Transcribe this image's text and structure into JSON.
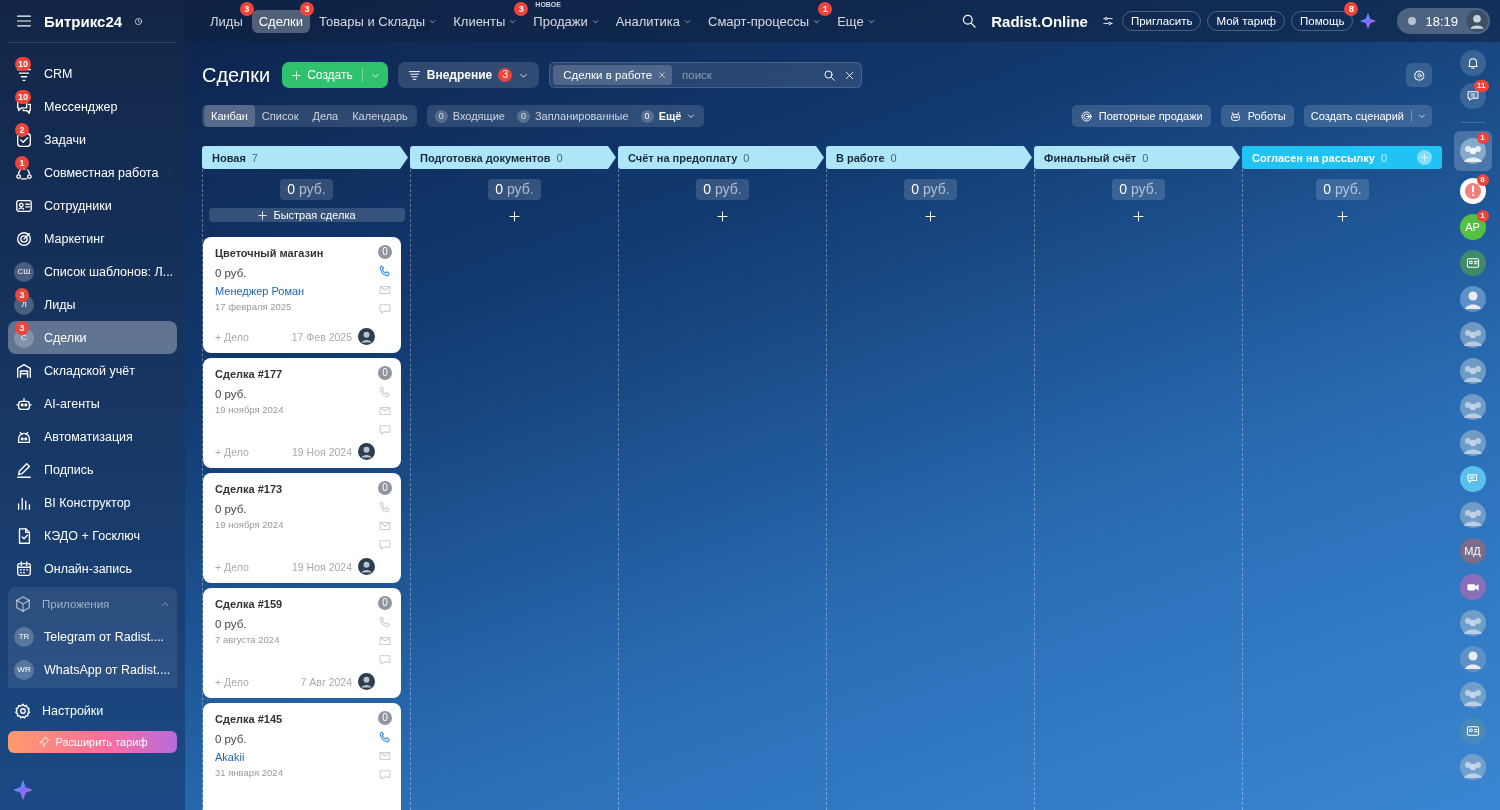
{
  "sidebar": {
    "logo": "Битрикс24",
    "items": [
      {
        "kind": "crm",
        "label": "CRM",
        "badge": "10",
        "submenu": false,
        "selected": false
      },
      {
        "kind": "messenger",
        "label": "Мессенджер",
        "badge": "10",
        "submenu": false,
        "selected": false
      },
      {
        "kind": "tasks",
        "label": "Задачи",
        "badge": "2",
        "submenu": false,
        "selected": false
      },
      {
        "kind": "collab",
        "label": "Совместная работа",
        "badge": "1",
        "submenu": true,
        "selected": false
      },
      {
        "kind": "staff",
        "label": "Сотрудники",
        "submenu": false,
        "selected": false
      },
      {
        "kind": "marketing",
        "label": "Маркетинг",
        "submenu": false,
        "selected": false
      },
      {
        "kind": "initials",
        "initials": "СШ",
        "label": "Список шаблонов: Л...",
        "submenu": false,
        "selected": false
      },
      {
        "kind": "initials",
        "initials": "Л",
        "label": "Лиды",
        "badge": "3",
        "submenu": false,
        "selected": false
      },
      {
        "kind": "initials",
        "initials": "С",
        "label": "Сделки",
        "badge": "3",
        "submenu": false,
        "selected": true
      },
      {
        "kind": "warehouse",
        "label": "Складской учёт",
        "submenu": false,
        "selected": false
      },
      {
        "kind": "ai",
        "label": "AI-агенты",
        "submenu": false,
        "selected": false
      },
      {
        "kind": "automation",
        "label": "Автоматизация",
        "submenu": false,
        "selected": false
      },
      {
        "kind": "sign",
        "label": "Подпись",
        "submenu": false,
        "selected": false
      },
      {
        "kind": "bi",
        "label": "BI Конструктор",
        "submenu": false,
        "selected": false
      },
      {
        "kind": "kedo",
        "label": "КЭДО + Госключ",
        "submenu": false,
        "selected": false
      },
      {
        "kind": "booking",
        "label": "Онлайн-запись",
        "submenu": false,
        "selected": false
      }
    ],
    "apps": {
      "title": "Приложения",
      "expanded": true,
      "items": [
        {
          "initials": "TR",
          "label": "Telegram от Radist...."
        },
        {
          "initials": "WR",
          "label": "WhatsApp от Radist...."
        }
      ]
    },
    "settings": "Настройки",
    "upgrade_button": "Расширить тариф"
  },
  "top_nav": {
    "items": [
      {
        "label": "Лиды",
        "badge": "3",
        "dropdown": false,
        "selected": false
      },
      {
        "label": "Сделки",
        "badge": "3",
        "dropdown": false,
        "selected": true
      },
      {
        "label": "Товары и Склады",
        "dropdown": true,
        "selected": false
      },
      {
        "label": "Клиенты",
        "badge": "3",
        "dropdown": true,
        "selected": false
      },
      {
        "label": "Продажи",
        "tag": "НОВОЕ",
        "dropdown": true,
        "selected": false
      },
      {
        "label": "Аналитика",
        "dropdown": true,
        "selected": false
      },
      {
        "label": "Смарт-процессы",
        "badge": "1",
        "dropdown": true,
        "selected": false
      },
      {
        "label": "Еще",
        "dropdown": true,
        "selected": false
      }
    ],
    "portal": "Radist.Online",
    "buttons": [
      "Пригласить",
      "Мой тариф"
    ],
    "help": {
      "label": "Помощь",
      "badge": "8"
    },
    "time": "18:19"
  },
  "toolbar": {
    "title": "Сделки",
    "create_button": "Создать",
    "pipeline": {
      "label": "Внедрение",
      "badge": "3"
    },
    "filter": {
      "chip": "Сделки в работе",
      "placeholder": "поиск"
    },
    "view_tabs": [
      {
        "label": "Канбан",
        "selected": true
      },
      {
        "label": "Список",
        "selected": false
      },
      {
        "label": "Дела",
        "selected": false
      },
      {
        "label": "Календарь",
        "selected": false
      }
    ],
    "counters": [
      {
        "count": "0",
        "label": "Входящие",
        "dropdown": false
      },
      {
        "count": "0",
        "label": "Запланированные",
        "dropdown": false
      },
      {
        "count": "0",
        "label": "Ещё",
        "dropdown": true
      }
    ],
    "actions": [
      {
        "kind": "repeat",
        "label": "Повторные продажи"
      },
      {
        "kind": "robots",
        "label": "Роботы"
      }
    ],
    "scenario_button": "Создать сценарий"
  },
  "kanban": {
    "columns": [
      {
        "title": "Новая",
        "count": "7",
        "color": "#aee6f9",
        "last": false,
        "total_value": "0",
        "total_unit": "руб.",
        "quick_add": "Быстрая сделка",
        "cards": [
          {
            "title": "Цветочный магазин",
            "amount": "0 руб.",
            "contact": "Менеджер Роман",
            "date": "17 февраля 2025",
            "activity": "+ Дело",
            "short_date": "17 Фев 2025",
            "counter": "0",
            "phone_active": true
          },
          {
            "title": "Сделка #177",
            "amount": "0 руб.",
            "date": "19 ноября 2024",
            "activity": "+ Дело",
            "short_date": "19 Ноя 2024",
            "counter": "0",
            "phone_active": false
          },
          {
            "title": "Сделка #173",
            "amount": "0 руб.",
            "date": "19 ноября 2024",
            "activity": "+ Дело",
            "short_date": "19 Ноя 2024",
            "counter": "0",
            "phone_active": false
          },
          {
            "title": "Сделка #159",
            "amount": "0 руб.",
            "date": "7 августа 2024",
            "activity": "+ Дело",
            "short_date": "7 Авг 2024",
            "counter": "0",
            "phone_active": false
          },
          {
            "title": "Сделка #145",
            "amount": "0 руб.",
            "contact": "Akakii",
            "date": "31 января 2024",
            "counter": "0",
            "phone_active": true
          }
        ]
      },
      {
        "title": "Подготовка документов",
        "count": "0",
        "color": "#aee6f9",
        "last": false,
        "total_value": "0",
        "total_unit": "руб."
      },
      {
        "title": "Счёт на предоплату",
        "count": "0",
        "color": "#aee6f9",
        "last": false,
        "total_value": "0",
        "total_unit": "руб."
      },
      {
        "title": "В работе",
        "count": "0",
        "color": "#aee6f9",
        "last": false,
        "total_value": "0",
        "total_unit": "руб."
      },
      {
        "title": "Финальный счёт",
        "count": "0",
        "color": "#aee6f9",
        "last": false,
        "total_value": "0",
        "total_unit": "руб."
      },
      {
        "title": "Согласен на рассылку",
        "count": "0",
        "color": "#1fc4f5",
        "total_value": "0",
        "total_unit": "руб.",
        "last": true
      }
    ]
  },
  "right_rail": {
    "items": [
      {
        "kind": "bell",
        "selected": false
      },
      {
        "kind": "chat",
        "badge": "11",
        "selected": false
      },
      {
        "kind": "group",
        "badge": "1",
        "selected": true
      },
      {
        "kind": "alert",
        "badge": "8",
        "selected": false
      },
      {
        "kind": "initials",
        "initials": "AP",
        "color": "#55c041",
        "badge": "1",
        "selected": false
      },
      {
        "kind": "card",
        "color": "#3f8a6a",
        "selected": false
      },
      {
        "kind": "person",
        "selected": false
      },
      {
        "kind": "group",
        "selected": false
      },
      {
        "kind": "group",
        "selected": false
      },
      {
        "kind": "group",
        "selected": false
      },
      {
        "kind": "group",
        "selected": false
      },
      {
        "kind": "messages",
        "selected": false
      },
      {
        "kind": "group",
        "selected": false
      },
      {
        "kind": "initials",
        "initials": "МД",
        "color": "#7a6c8a",
        "selected": false
      },
      {
        "kind": "video",
        "selected": false
      },
      {
        "kind": "group",
        "selected": false
      },
      {
        "kind": "person",
        "selected": false
      },
      {
        "kind": "group",
        "selected": false
      },
      {
        "kind": "card",
        "color": "#4a88b8",
        "selected": false
      },
      {
        "kind": "group",
        "selected": false
      }
    ]
  }
}
